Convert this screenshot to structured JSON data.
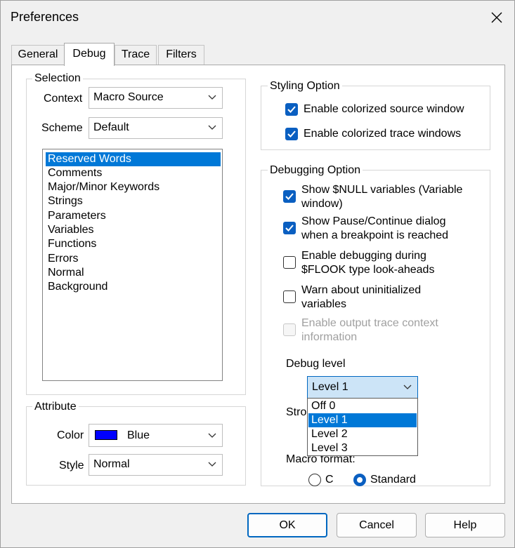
{
  "window": {
    "title": "Preferences"
  },
  "tabs": [
    {
      "label": "General"
    },
    {
      "label": "Debug"
    },
    {
      "label": "Trace"
    },
    {
      "label": "Filters"
    }
  ],
  "selection": {
    "group_label": "Selection",
    "context_label": "Context",
    "context_value": "Macro Source",
    "scheme_label": "Scheme",
    "scheme_value": "Default",
    "items": [
      "Reserved Words",
      "Comments",
      "Major/Minor Keywords",
      "Strings",
      "Parameters",
      "Variables",
      "Functions",
      "Errors",
      "Normal",
      "Background"
    ],
    "selected_index": 0
  },
  "attribute": {
    "group_label": "Attribute",
    "color_label": "Color",
    "color_value": "Blue",
    "color_swatch": "#0000ff",
    "style_label": "Style",
    "style_value": "Normal"
  },
  "styling": {
    "group_label": "Styling Option",
    "options": [
      {
        "label": "Enable colorized source window",
        "checked": true
      },
      {
        "label": "Enable colorized trace windows",
        "checked": true
      }
    ]
  },
  "debugging": {
    "group_label": "Debugging Option",
    "options": [
      {
        "line1": "Show $NULL variables (Variable",
        "line2": "window)",
        "checked": true,
        "enabled": true
      },
      {
        "line1": "Show Pause/Continue dialog",
        "line2": "when a breakpoint is reached",
        "checked": true,
        "enabled": true
      },
      {
        "line1": "Enable debugging during",
        "line2": "$FLOOK type look-aheads",
        "checked": false,
        "enabled": true
      },
      {
        "line1": "Warn about uninitialized",
        "line2": "variables",
        "checked": false,
        "enabled": true
      },
      {
        "line1": "Enable output trace context",
        "line2": "information",
        "checked": false,
        "enabled": false
      }
    ],
    "debug_level_label": "Debug level",
    "debug_level_value": "Level 1",
    "debug_level_options": [
      "Off 0",
      "Level 1",
      "Level 2",
      "Level 3"
    ],
    "debug_level_selected": 1,
    "stro_partial": "Stro",
    "macro_format_label": "Macro format:",
    "macro_format_options": [
      {
        "label": "C",
        "checked": false
      },
      {
        "label": "Standard",
        "checked": true
      }
    ]
  },
  "buttons": {
    "ok": "OK",
    "cancel": "Cancel",
    "help": "Help"
  },
  "colors": {
    "accent": "#0078d7",
    "checkbox": "#0a5fc1",
    "default_button_border": "#0067c0"
  }
}
